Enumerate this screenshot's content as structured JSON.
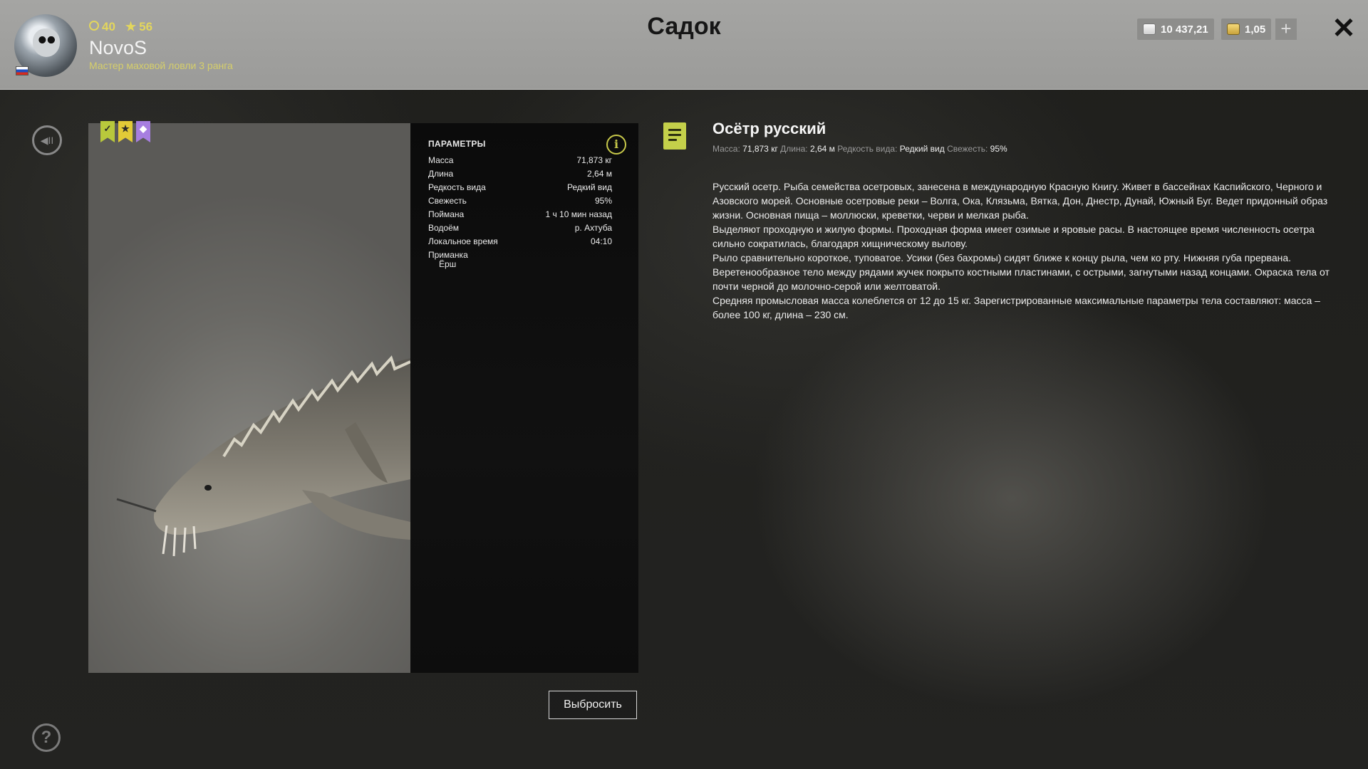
{
  "header": {
    "title": "Садок",
    "user": {
      "level": "40",
      "rating": "56",
      "name": "NovoS",
      "rank": "Мастер маховой ловли 3 ранга"
    },
    "currency": {
      "silver": "10 437,21",
      "gold": "1,05"
    },
    "icons": {
      "close": "close-icon",
      "plus": "plus-icon",
      "silver": "silver-coin-icon",
      "gold": "gold-coin-icon"
    }
  },
  "fish": {
    "name": "Осётр русский",
    "badges": [
      "check",
      "star",
      "rare-diamond"
    ],
    "summary": {
      "mass_label": "Масса:",
      "mass": "71,873 кг",
      "length_label": "Длина:",
      "length": "2,64 м",
      "rarity_label": "Редкость вида:",
      "rarity": "Редкий вид",
      "freshness_label": "Свежесть:",
      "freshness": "95%"
    },
    "description": [
      "Русский осетр. Рыба семейства осетровых, занесена в международную Красную Книгу. Живет в бассейнах Каспийского, Черного и Азовского морей. Основные осетровые реки – Волга, Ока, Клязьма, Вятка, Дон, Днестр, Дунай, Южный Буг. Ведет придонный образ жизни. Основная пища – моллюски, креветки, черви и мелкая рыба.",
      " Выделяют проходную и жилую формы. Проходная форма имеет озимые и яровые расы. В настоящее время численность осетра сильно сократилась, благодаря хищническому вылову.",
      "Рыло сравнительно короткое, туповатое. Усики (без бахромы) сидят ближе к концу рыла, чем ко рту. Нижняя губа прервана. Веретенообразное тело между рядами жучек покрыто костными пластинами, с острыми, загнутыми назад концами. Окраска тела от почти черной до молочно-серой или желтоватой.",
      "Средняя промысловая масса колеблется от 12 до 15 кг. Зарегистрированные максимальные параметры тела составляют: масса – более 100 кг, длина – 230 см."
    ]
  },
  "params": {
    "title": "ПАРАМЕТРЫ",
    "rows": [
      {
        "label": "Масса",
        "value": "71,873 кг"
      },
      {
        "label": "Длина",
        "value": "2,64 м"
      },
      {
        "label": "Редкость вида",
        "value": "Редкий вид"
      },
      {
        "label": "Свежесть",
        "value": "95%"
      },
      {
        "label": "Поймана",
        "value": "1 ч 10 мин назад"
      },
      {
        "label": "Водоём",
        "value": "р. Ахтуба"
      },
      {
        "label": "Локальное время",
        "value": "04:10"
      }
    ],
    "lure_label": "Приманка",
    "lure_value": "Ёрш"
  },
  "actions": {
    "discard": "Выбросить",
    "help": "?"
  },
  "colors": {
    "accent_yellow": "#e3d65c",
    "note_green": "#c4d04a",
    "badge_purple": "#a77ee0"
  }
}
